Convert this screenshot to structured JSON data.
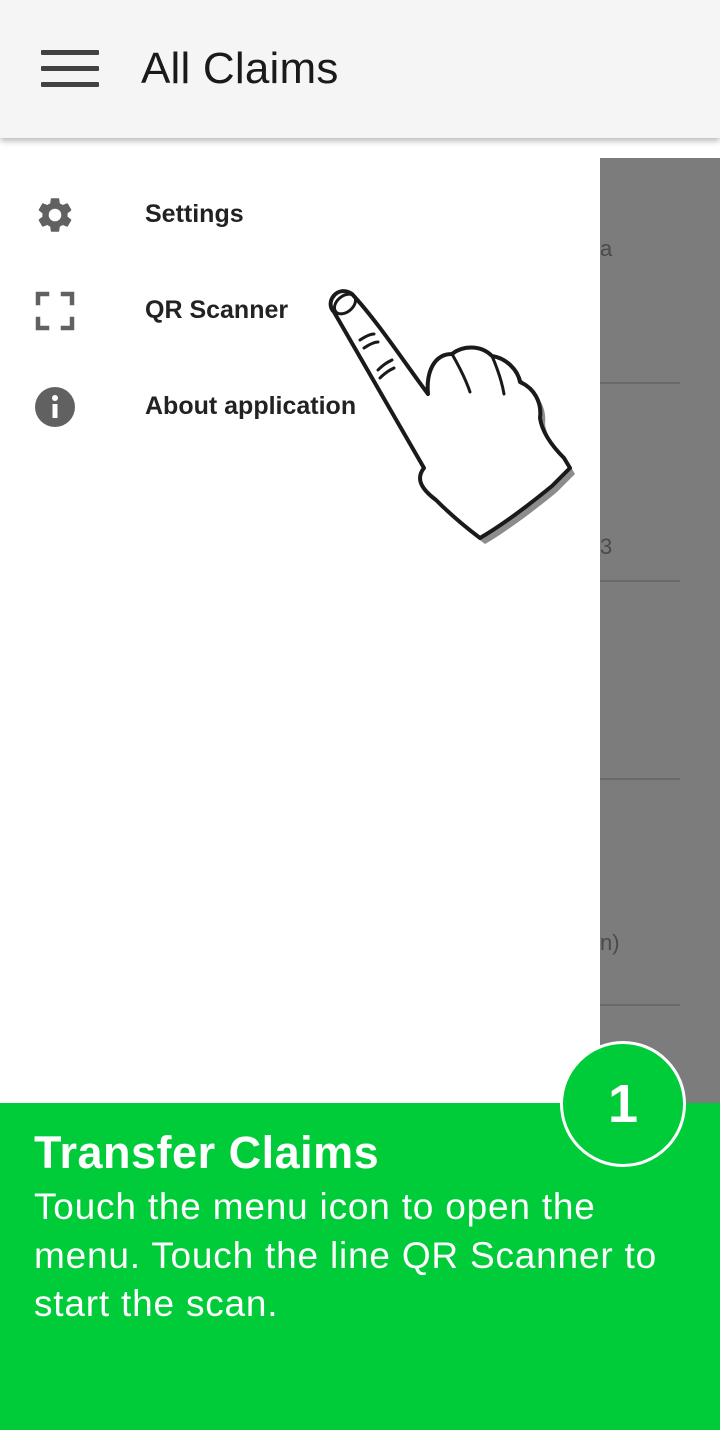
{
  "app_bar": {
    "title": "All Claims",
    "menu_icon": "hamburger-menu-icon"
  },
  "underlay": {
    "fragments": [
      "a",
      "3",
      "n)"
    ]
  },
  "drawer": {
    "items": [
      {
        "label": "Settings",
        "icon": "gear-icon"
      },
      {
        "label": "QR Scanner",
        "icon": "qr-scan-frame-icon"
      },
      {
        "label": "About application",
        "icon": "info-icon"
      }
    ]
  },
  "tip": {
    "step_number": "1",
    "title": "Transfer Claims",
    "text": "Touch the menu icon to open the menu. Touch the line QR Scanner to start the scan."
  },
  "colors": {
    "banner": "#00cc3a",
    "app_bar": "#f5f5f5",
    "underlay": "#7c7c7c",
    "icon": "#616161"
  }
}
